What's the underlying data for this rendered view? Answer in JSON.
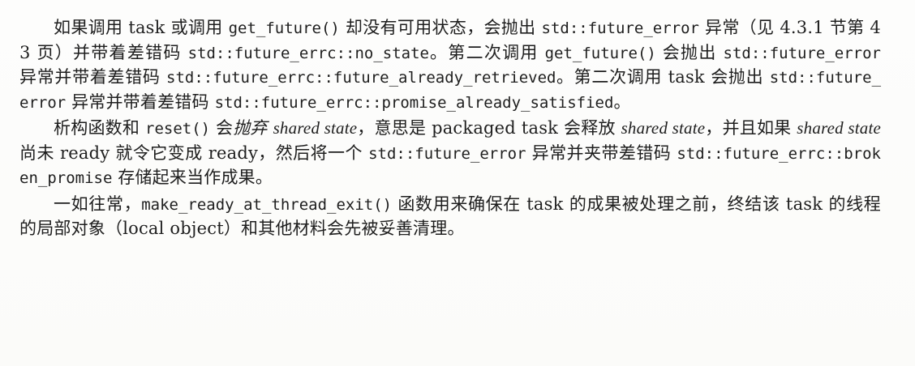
{
  "paragraphs": [
    {
      "segments": [
        {
          "t": "text",
          "v": "如果调用 task 或调用 "
        },
        {
          "t": "code",
          "v": "get_future()"
        },
        {
          "t": "text",
          "v": " 却没有可用状态，会抛出 "
        },
        {
          "t": "code",
          "v": "std::future_error"
        },
        {
          "t": "text",
          "v": " 异常（见 4.3.1 节第 43 页）并带着差错码 "
        },
        {
          "t": "code",
          "v": "std::future_errc::no_state"
        },
        {
          "t": "text",
          "v": "。第二次调用 "
        },
        {
          "t": "code",
          "v": "get_future()"
        },
        {
          "t": "text",
          "v": " 会抛出 "
        },
        {
          "t": "code",
          "v": "std::future_error"
        },
        {
          "t": "text",
          "v": " 异常并带着差错码 "
        },
        {
          "t": "code",
          "v": "std::future_errc::future_already_retrieved"
        },
        {
          "t": "text",
          "v": "。第二次调用 task 会抛出 "
        },
        {
          "t": "code",
          "v": "std::future_error"
        },
        {
          "t": "text",
          "v": " 异常并带着差错码 "
        },
        {
          "t": "code",
          "v": "std::future_errc::promise_already_satisfied"
        },
        {
          "t": "text",
          "v": "。"
        }
      ]
    },
    {
      "segments": [
        {
          "t": "text",
          "v": "析构函数和 "
        },
        {
          "t": "code",
          "v": "reset()"
        },
        {
          "t": "text",
          "v": " 会"
        },
        {
          "t": "em",
          "v": "抛弃"
        },
        {
          "t": "text",
          "v": " "
        },
        {
          "t": "em",
          "v": "shared state"
        },
        {
          "t": "text",
          "v": "，意思是 packaged task 会释放 "
        },
        {
          "t": "em",
          "v": "shared state"
        },
        {
          "t": "text",
          "v": "，并且如果 "
        },
        {
          "t": "em",
          "v": "shared state"
        },
        {
          "t": "text",
          "v": " 尚未 ready 就令它变成 ready，然后将一个 "
        },
        {
          "t": "code",
          "v": "std::future_error"
        },
        {
          "t": "text",
          "v": " 异常并夹带差错码 "
        },
        {
          "t": "code",
          "v": "std::future_errc::broken_promise"
        },
        {
          "t": "text",
          "v": " 存储起来当作成果。"
        }
      ]
    },
    {
      "segments": [
        {
          "t": "text",
          "v": "一如往常，"
        },
        {
          "t": "code",
          "v": "make_ready_at_thread_exit()"
        },
        {
          "t": "text",
          "v": " 函数用来确保在 task 的成果被处理之前，终结该 task 的线程的局部对象（local object）和其他材料会先被妥善清理。"
        }
      ]
    }
  ]
}
